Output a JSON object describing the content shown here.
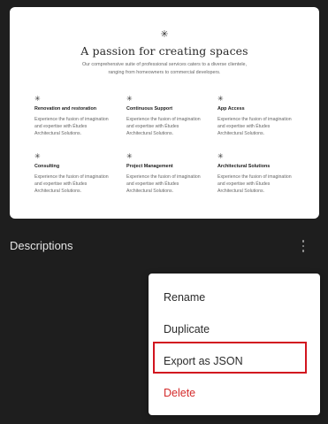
{
  "preview": {
    "star": "✳",
    "title": "A passion for creating spaces",
    "subtitle_line1": "Our comprehensive suite of professional services caters to a diverse clientele,",
    "subtitle_line2": "ranging from homeowners to commercial developers.",
    "features": [
      {
        "icon": "asterisk-icon",
        "star": "✳",
        "title": "Renovation and restoration",
        "desc": "Experience the fusion of imagination\nand expertise with Études\nArchitectural Solutions."
      },
      {
        "icon": "asterisk-icon",
        "star": "✳",
        "title": "Continuous Support",
        "desc": "Experience the fusion of imagination\nand expertise with Études\nArchitectural Solutions."
      },
      {
        "icon": "asterisk-icon",
        "star": "✳",
        "title": "App Access",
        "desc": "Experience the fusion of imagination\nand expertise with Études\nArchitectural Solutions."
      },
      {
        "icon": "asterisk-icon",
        "star": "✳",
        "title": "Consulting",
        "desc": "Experience the fusion of imagination\nand expertise with Études\nArchitectural Solutions."
      },
      {
        "icon": "asterisk-icon",
        "star": "✳",
        "title": "Project Management",
        "desc": "Experience the fusion of imagination\nand expertise with Études\nArchitectural Solutions."
      },
      {
        "icon": "asterisk-icon",
        "star": "✳",
        "title": "Architectural Solutions",
        "desc": "Experience the fusion of imagination\nand expertise with Études\nArchitectural Solutions."
      }
    ]
  },
  "pattern": {
    "name": "Descriptions",
    "options_icon": "more-vertical-icon"
  },
  "menu": {
    "rename": "Rename",
    "duplicate": "Duplicate",
    "export_json": "Export as JSON",
    "delete": "Delete"
  },
  "colors": {
    "background": "#1e1e1e",
    "delete_text": "#d42b2b",
    "highlight_border": "#d2151f"
  }
}
